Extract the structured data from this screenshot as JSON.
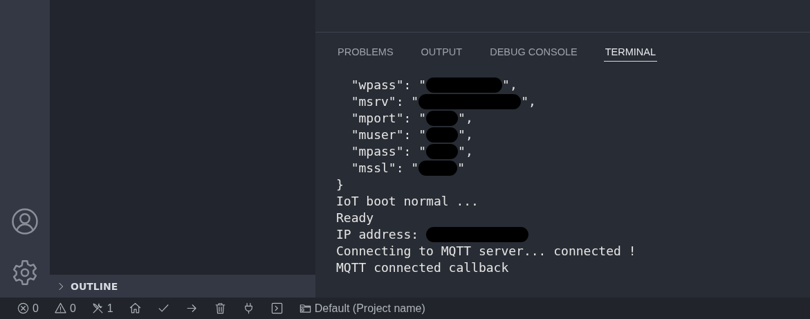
{
  "activity_bar": {
    "items": [
      {
        "kind": "account"
      },
      {
        "kind": "settings"
      }
    ]
  },
  "sidebar": {
    "sections": [
      {
        "label": "OUTLINE",
        "expanded": false
      }
    ]
  },
  "panel": {
    "tabs": [
      {
        "label": "PROBLEMS",
        "selected": false
      },
      {
        "label": "OUTPUT",
        "selected": false
      },
      {
        "label": "DEBUG CONSOLE",
        "selected": false
      },
      {
        "label": "TERMINAL",
        "selected": true
      }
    ],
    "terminal_lines": [
      {
        "before": "  \"wpass\": \"",
        "redaction": {
          "kind": "long"
        },
        "after": "\","
      },
      {
        "before": "  \"msrv\": \"",
        "redaction": {
          "kind": "xlong"
        },
        "after": "\","
      },
      {
        "before": "  \"mport\": \"",
        "redaction": {
          "kind": "short"
        },
        "after": "\","
      },
      {
        "before": "  \"muser\": \"",
        "redaction": {
          "kind": "short"
        },
        "after": "\","
      },
      {
        "before": "  \"mpass\": \"",
        "redaction": {
          "kind": "short"
        },
        "after": "\","
      },
      {
        "before": "  \"mssl\": \"",
        "redaction": {
          "kind": "medium"
        },
        "after": "\""
      },
      {
        "before": "}"
      },
      {
        "before": "IoT boot normal ..."
      },
      {
        "before": "Ready"
      },
      {
        "before": "IP address: ",
        "redaction": {
          "kind": "xlong"
        }
      },
      {
        "before": "Connecting to MQTT server... connected !"
      },
      {
        "before": "MQTT connected callback"
      }
    ]
  },
  "status_bar": {
    "items": [
      {
        "kind": "error",
        "text": "0"
      },
      {
        "kind": "warning",
        "text": "0"
      },
      {
        "kind": "tools",
        "text": "1"
      },
      {
        "kind": "home"
      },
      {
        "kind": "check"
      },
      {
        "kind": "arrow"
      },
      {
        "kind": "trash"
      },
      {
        "kind": "plug"
      },
      {
        "kind": "terminal"
      },
      {
        "kind": "folder",
        "text": "Default (Project name)"
      }
    ]
  }
}
